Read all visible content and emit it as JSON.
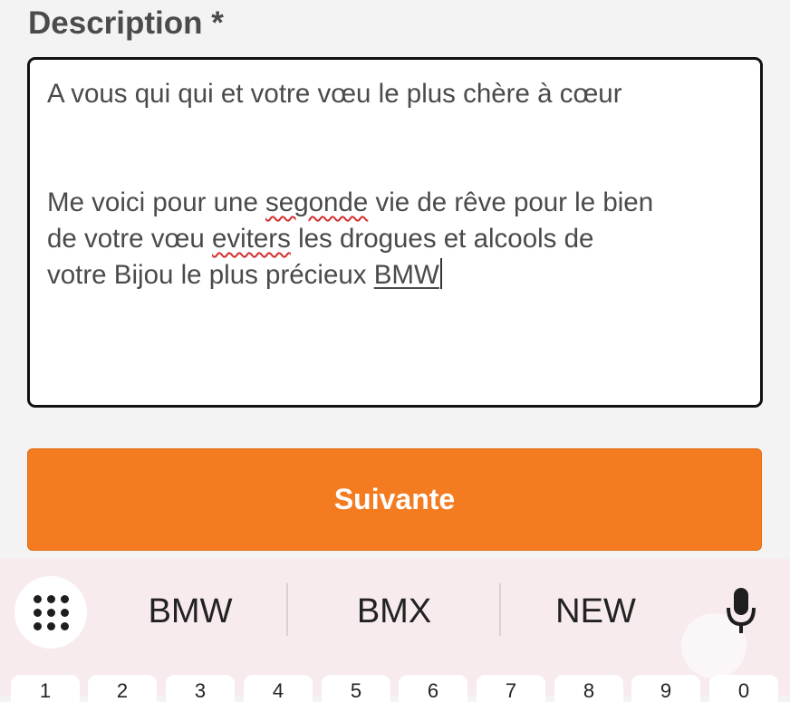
{
  "form": {
    "description_label": "Description *",
    "description_text": {
      "line1": "A vous qui qui et votre vœu le plus chère à cœur",
      "line2_a": "Me voici pour une ",
      "line2_misspelled": "segonde",
      "line2_b": " vie de rêve pour le bien",
      "line3_a": "de votre vœu ",
      "line3_misspelled": "eviters",
      "line3_b": " les drogues et alcools de",
      "line4_a": "votre Bijou le plus précieux ",
      "line4_composing": "BMW"
    },
    "next_button_label": "Suivante"
  },
  "keyboard": {
    "menu_icon": "grid-menu-icon",
    "suggestions": [
      "BMW",
      "BMX",
      "NEW"
    ],
    "mic_icon": "microphone-icon",
    "number_row": [
      "1",
      "2",
      "3",
      "4",
      "5",
      "6",
      "7",
      "8",
      "9",
      "0"
    ]
  },
  "colors": {
    "accent": "#f47b20",
    "keyboard_bg": "#f7ebee",
    "spellcheck": "#d32f2f"
  }
}
